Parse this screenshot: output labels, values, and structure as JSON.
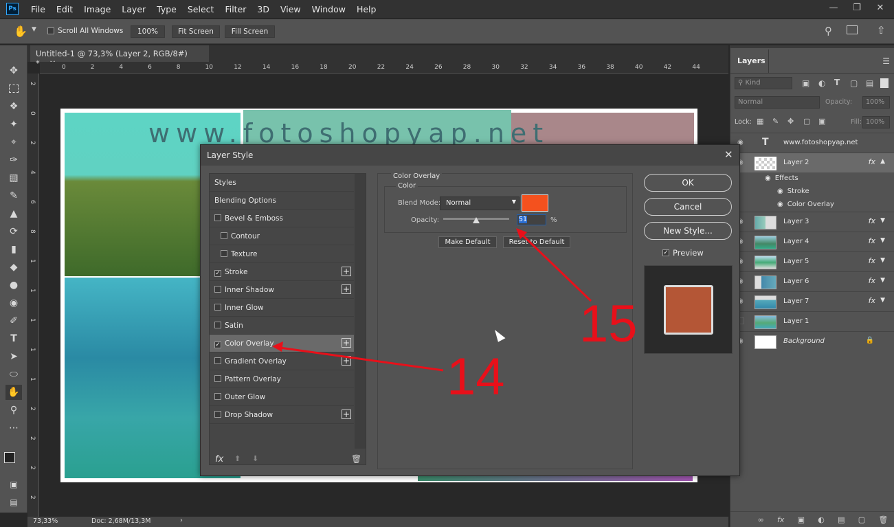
{
  "menubar": {
    "logo": "Ps",
    "items": [
      "File",
      "Edit",
      "Image",
      "Layer",
      "Type",
      "Select",
      "Filter",
      "3D",
      "View",
      "Window",
      "Help"
    ]
  },
  "options": {
    "scroll_all_windows": "Scroll All Windows",
    "zoom": "100%",
    "fit_screen": "Fit Screen",
    "fill_screen": "Fill Screen"
  },
  "document": {
    "tab_title": "Untitled-1 @ 73,3% (Layer 2, RGB/8#) *",
    "watermark": "www.fotoshopyap.net",
    "ruler_h": [
      "0",
      "2",
      "4",
      "6",
      "8",
      "10",
      "12",
      "14",
      "16",
      "18",
      "20",
      "22",
      "24",
      "26",
      "28",
      "30",
      "32",
      "34",
      "36",
      "38",
      "40",
      "42",
      "44"
    ],
    "ruler_v": [
      "2",
      "0",
      "2",
      "4",
      "6",
      "8",
      "1",
      "1",
      "1",
      "1",
      "1",
      "2",
      "2",
      "2",
      "2"
    ]
  },
  "status": {
    "zoom": "73,33%",
    "doc": "Doc: 2,68M/13,3M"
  },
  "layers_panel": {
    "title": "Layers",
    "kind": "Kind",
    "blend": "Normal",
    "opacity_label": "Opacity:",
    "opacity_value": "100%",
    "lock_label": "Lock:",
    "fill_label": "Fill:",
    "fill_value": "100%",
    "effects_label": "Effects",
    "stroke_label": "Stroke",
    "color_overlay_label": "Color Overlay",
    "fx_label": "fx",
    "type_glyph": "T",
    "layers": [
      {
        "name": "www.fotoshopyap.net"
      },
      {
        "name": "Layer 2"
      },
      {
        "name": "Layer 3"
      },
      {
        "name": "Layer 4"
      },
      {
        "name": "Layer 5"
      },
      {
        "name": "Layer 6"
      },
      {
        "name": "Layer 7"
      },
      {
        "name": "Layer 1"
      },
      {
        "name": "Background"
      }
    ]
  },
  "dialog": {
    "title": "Layer Style",
    "styles": [
      {
        "label": "Styles"
      },
      {
        "label": "Blending Options"
      },
      {
        "label": "Bevel & Emboss"
      },
      {
        "label": "Contour"
      },
      {
        "label": "Texture"
      },
      {
        "label": "Stroke"
      },
      {
        "label": "Inner Shadow"
      },
      {
        "label": "Inner Glow"
      },
      {
        "label": "Satin"
      },
      {
        "label": "Color Overlay"
      },
      {
        "label": "Gradient Overlay"
      },
      {
        "label": "Pattern Overlay"
      },
      {
        "label": "Outer Glow"
      },
      {
        "label": "Drop Shadow"
      }
    ],
    "fx_label": "fx",
    "section_title": "Color Overlay",
    "group_title": "Color",
    "blend_mode_label": "Blend Mode:",
    "blend_mode_value": "Normal",
    "overlay_color": "#f4511e",
    "opacity_label": "Opacity:",
    "opacity_value": "51",
    "opacity_unit": "%",
    "make_default": "Make Default",
    "reset_default": "Reset to Default",
    "ok": "OK",
    "cancel": "Cancel",
    "new_style": "New Style...",
    "preview_label": "Preview",
    "preview_swatch": "#b45636"
  },
  "annotations": {
    "label_14": "14",
    "label_15": "15",
    "color": "#e8101a"
  }
}
